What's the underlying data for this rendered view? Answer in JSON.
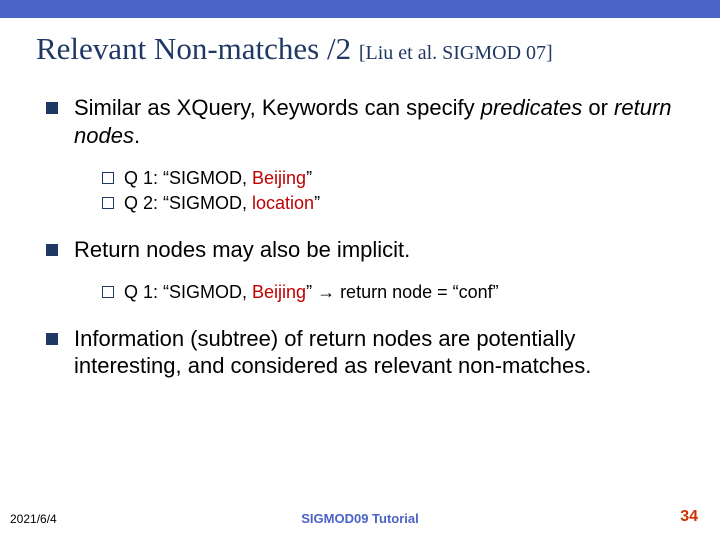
{
  "title": {
    "main": "Relevant Non-matches /2 ",
    "cite": "[Liu et al. SIGMOD 07]"
  },
  "bullets": {
    "b1": {
      "pre": "Similar as XQuery, Keywords can specify ",
      "em1": "predicates",
      "mid": " or ",
      "em2": "return nodes",
      "post": "."
    },
    "b1subs": [
      {
        "label": "Q 1: ",
        "q1": "“SIGMOD, ",
        "red": "Beijing",
        "q2": "”"
      },
      {
        "label": "Q 2: ",
        "q1": "“SIGMOD, ",
        "red": "location",
        "q2": "”"
      }
    ],
    "b2": {
      "text": "Return nodes may also be implicit."
    },
    "b2subs": [
      {
        "label": "Q 1: ",
        "q1": "“SIGMOD, ",
        "red": "Beijing",
        "q2": "” ",
        "arrow": "→",
        "after": " return node = “conf”"
      }
    ],
    "b3": {
      "text": "Information (subtree) of return nodes are potentially interesting, and considered as relevant non-matches."
    }
  },
  "footer": {
    "left": "2021/6/4",
    "center": "SIGMOD09 Tutorial",
    "right": "34"
  }
}
